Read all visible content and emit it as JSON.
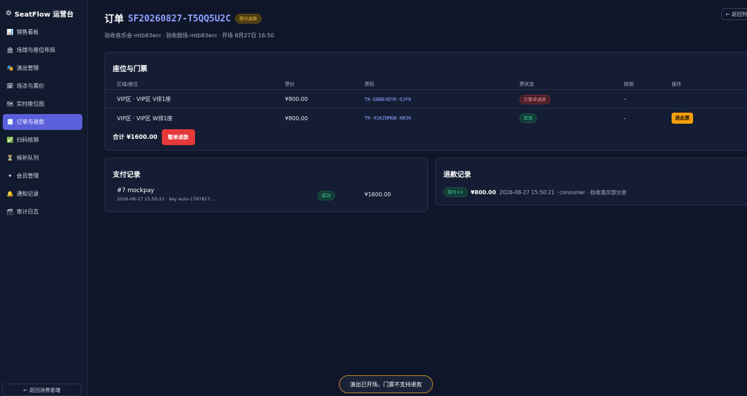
{
  "app": {
    "brand": "SeatFlow 运营台",
    "brand_icon": "gear-icon"
  },
  "sidebar": {
    "items": [
      {
        "label": "销售看板",
        "icon": "📊",
        "icon_name": "chart-icon"
      },
      {
        "label": "场馆与座位布局",
        "icon": "🏛",
        "icon_name": "building-icon"
      },
      {
        "label": "演出管理",
        "icon": "🎭",
        "icon_name": "theater-icon"
      },
      {
        "label": "场次与票价",
        "icon": "🗓",
        "icon_name": "calendar-icon"
      },
      {
        "label": "实时座位图",
        "icon": "🗺",
        "icon_name": "map-icon"
      },
      {
        "label": "订单与退款",
        "icon": "🧾",
        "icon_name": "receipt-icon",
        "active": true
      },
      {
        "label": "扫码核销",
        "icon": "✅",
        "icon_name": "check-icon"
      },
      {
        "label": "候补队列",
        "icon": "⏳",
        "icon_name": "hourglass-icon"
      },
      {
        "label": "会员管理",
        "icon": "✦",
        "icon_name": "star-icon"
      },
      {
        "label": "通知记录",
        "icon": "🔔",
        "icon_name": "bell-icon"
      },
      {
        "label": "审计日志",
        "icon": "🗃",
        "icon_name": "archive-icon"
      }
    ],
    "back_consumer": "← 返回消费者端"
  },
  "header": {
    "title_prefix": "订单",
    "order_no": "SF20260827-T5QQ5U2C",
    "status_badge": "部分退款",
    "subtitle": "验收音乐会-mtb83eni · 验收剧场-mtb83eni · 开场 8月27日 16:50",
    "back_list": "← 返回列表"
  },
  "seats": {
    "title": "座位与门票",
    "columns": [
      "区域/座位",
      "票价",
      "票码",
      "票状态",
      "核销",
      "操作"
    ],
    "rows": [
      {
        "seat": "VIP区 · VIP区 V排1座",
        "price": "¥800.00",
        "code": "TK-EBBE4DYK-QJF8",
        "status": "已整单退款",
        "checkin": "-",
        "action": ""
      },
      {
        "seat": "VIP区 · VIP区 W排1座",
        "price": "¥800.00",
        "code": "TK-4SKZNMGB-KB36",
        "status": "有效",
        "checkin": "-",
        "action": "退此票"
      }
    ],
    "total": "合计 ¥1600.00",
    "refund_all": "整单退款"
  },
  "payments": {
    "title": "支付记录",
    "items": [
      {
        "line1": "#7 mockpay",
        "line2": "2026-08-27 15:50:21 · key auto-1787817…",
        "status": "成功",
        "amount": "¥1600.00"
      }
    ]
  },
  "refunds": {
    "title": "退款记录",
    "items": [
      {
        "badge": "部分×1",
        "amount": "¥800.00",
        "detail": "2026-08-27 15:50:21 · consumer · 验收演示部分退"
      }
    ]
  },
  "toast": "演出已开场，门票不支持退款",
  "colors": {
    "background": "#0f1629",
    "sidebar": "#111a2e",
    "active_nav": "#5b5fdb",
    "accent_link": "#8ea2ff",
    "danger": "#e5383b",
    "warning": "#f59e0b",
    "success": "#45d3a8"
  }
}
